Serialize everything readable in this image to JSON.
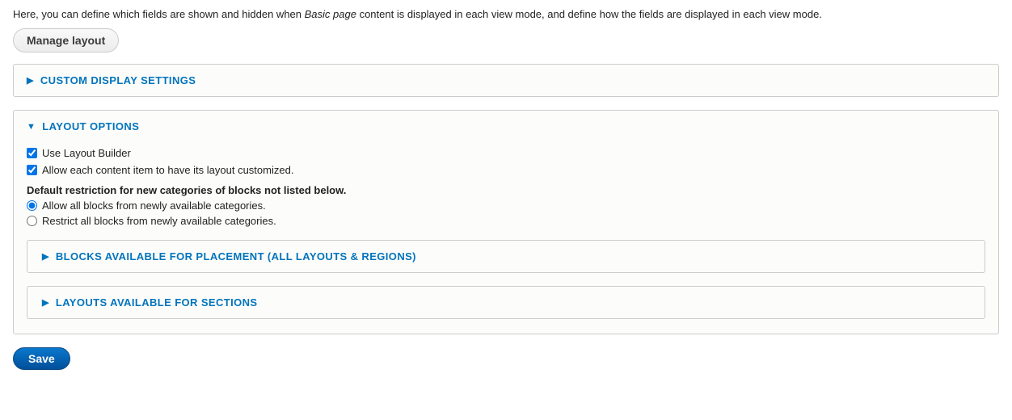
{
  "intro": {
    "prefix": "Here, you can define which fields are shown and hidden when ",
    "emphasis": "Basic page",
    "suffix": " content is displayed in each view mode, and define how the fields are displayed in each view mode."
  },
  "manage_layout_label": "Manage layout",
  "custom_display": {
    "title": "Custom display settings"
  },
  "layout_options": {
    "title": "Layout options",
    "use_layout_builder": "Use Layout Builder",
    "allow_each_item": "Allow each content item to have its layout customized.",
    "restriction_heading": "Default restriction for new categories of blocks not listed below.",
    "radio_allow": "Allow all blocks from newly available categories.",
    "radio_restrict": "Restrict all blocks from newly available categories.",
    "blocks_available_title": "Blocks available for placement (all layouts & regions)",
    "layouts_available_title": "Layouts available for sections"
  },
  "save_label": "Save"
}
